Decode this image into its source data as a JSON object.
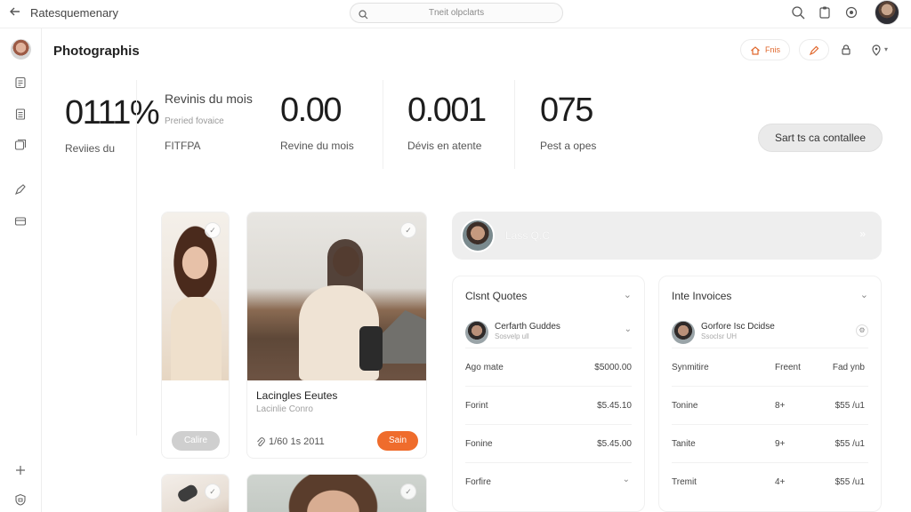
{
  "header": {
    "app_title": "Ratesquemenary",
    "search_placeholder": "Tneit olpclarts"
  },
  "page": {
    "title": "Photographis",
    "header_button_label": "Fnis"
  },
  "stats": {
    "s1": {
      "value": "0111%",
      "label": "Reviies du"
    },
    "s2": {
      "title": "Revinis du mois",
      "sub": "Preried fovaice",
      "extra": "FITFPA"
    },
    "s3": {
      "value": "0.00",
      "label": "Revine du mois"
    },
    "s4": {
      "value": "0.001",
      "label": "Dévis en atente"
    },
    "s5": {
      "value": "075",
      "label": "Pest a opes"
    },
    "cta_label": "Sart ts ca contallee"
  },
  "cards": {
    "c1": {
      "button_label": "Calire"
    },
    "c2": {
      "title": "Lacingles Eeutes",
      "subtitle": "Lacinlie Conro",
      "date": "1/60 1s 2011",
      "button_label": "Sain"
    }
  },
  "banner": {
    "text": "Lass Q.C"
  },
  "quotes": {
    "title": "Clsnt Quotes",
    "person": {
      "name": "Cerfarth Guddes",
      "sub": "Sosvelp ull"
    },
    "rows": [
      {
        "label": "Ago mate",
        "amount": "$5000.00"
      },
      {
        "label": "Forint",
        "amount": "$5.45.10"
      },
      {
        "label": "Fonine",
        "amount": "$5.45.00"
      },
      {
        "label": "Forfire",
        "amount": ""
      }
    ]
  },
  "invoices": {
    "title": "Inte Invoices",
    "person": {
      "name": "Gorfore Isc Dcidse",
      "sub": "Ssoclsr UH"
    },
    "header": {
      "c1": "Synmitire",
      "c2": "Freent",
      "c3": "Fad ynb"
    },
    "rows": [
      {
        "label": "Tonine",
        "qty": "8+",
        "price": "$55 /u1"
      },
      {
        "label": "Tanite",
        "qty": "9+",
        "price": "$55 /u1"
      },
      {
        "label": "Tremit",
        "qty": "4+",
        "price": "$55 /u1"
      }
    ]
  }
}
